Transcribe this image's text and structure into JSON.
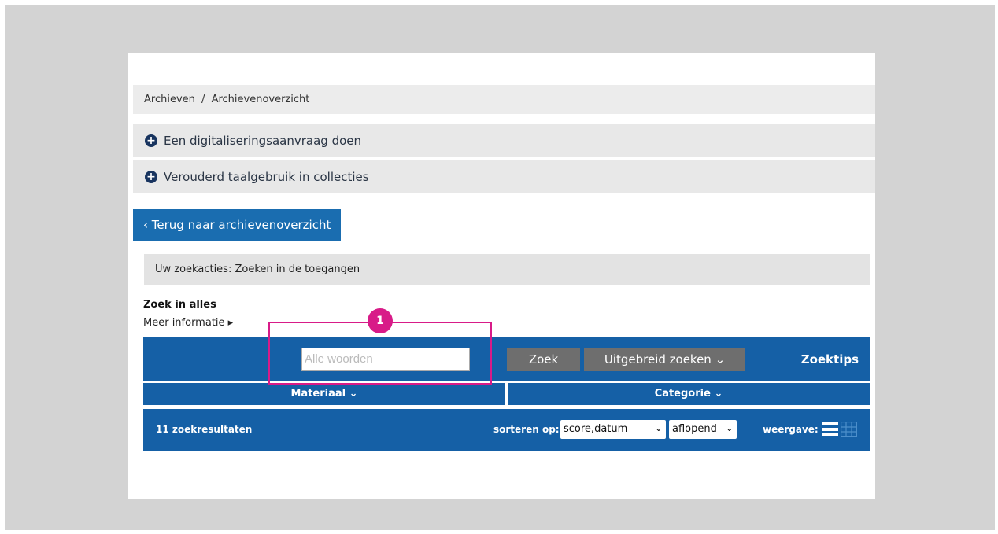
{
  "breadcrumb": {
    "items": [
      "Archieven",
      "Archievenoverzicht"
    ],
    "separator": "/"
  },
  "accordions": [
    {
      "label": "Een digitaliseringsaanvraag doen",
      "icon": "plus-circle-icon"
    },
    {
      "label": "Verouderd taalgebruik in collecties",
      "icon": "plus-circle-icon"
    }
  ],
  "back_button": {
    "label": "Terug naar archievenoverzicht",
    "icon": "chevron-left-icon"
  },
  "search_actions": {
    "text": "Uw zoekacties: Zoeken in de toegangen"
  },
  "search": {
    "heading": "Zoek in alles",
    "more_info": "Meer informatie ▸",
    "input_placeholder": "Alle woorden",
    "search_button": "Zoek",
    "advanced_button": "Uitgebreid zoeken ⌄",
    "tips_link": "Zoektips"
  },
  "filters": {
    "materiaal": "Materiaal ⌄",
    "categorie": "Categorie ⌄"
  },
  "results": {
    "count_text": "11 zoekresultaten",
    "sort_label": "sorteren op:",
    "sort_value": "score,datum",
    "order_value": "aflopend",
    "view_label": "weergave:"
  },
  "annotation": {
    "badge": "1"
  },
  "colors": {
    "primary_blue": "#1560a6",
    "button_blue": "#1a6db0",
    "gray_button": "#6e6e6e",
    "highlight_pink": "#d81b88",
    "frame_gray": "#d3d3d3"
  }
}
